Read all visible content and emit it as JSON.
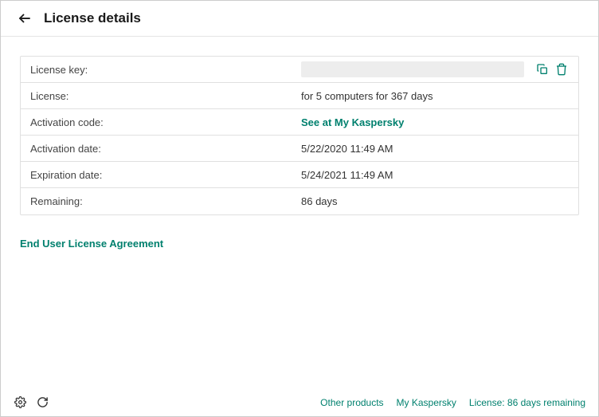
{
  "header": {
    "title": "License details"
  },
  "details": {
    "rows": [
      {
        "label": "License key:",
        "type": "masked"
      },
      {
        "label": "License:",
        "value": "for 5 computers for 367 days",
        "type": "text"
      },
      {
        "label": "Activation code:",
        "value": "See at My Kaspersky",
        "type": "link"
      },
      {
        "label": "Activation date:",
        "value": "5/22/2020 11:49 AM",
        "type": "text"
      },
      {
        "label": "Expiration date:",
        "value": "5/24/2021 11:49 AM",
        "type": "text"
      },
      {
        "label": "Remaining:",
        "value": "86 days",
        "type": "text"
      }
    ]
  },
  "eula": {
    "label": "End User License Agreement"
  },
  "footer": {
    "links": {
      "other_products": "Other products",
      "my_kaspersky": "My Kaspersky",
      "license_remaining": "License: 86 days remaining"
    }
  }
}
